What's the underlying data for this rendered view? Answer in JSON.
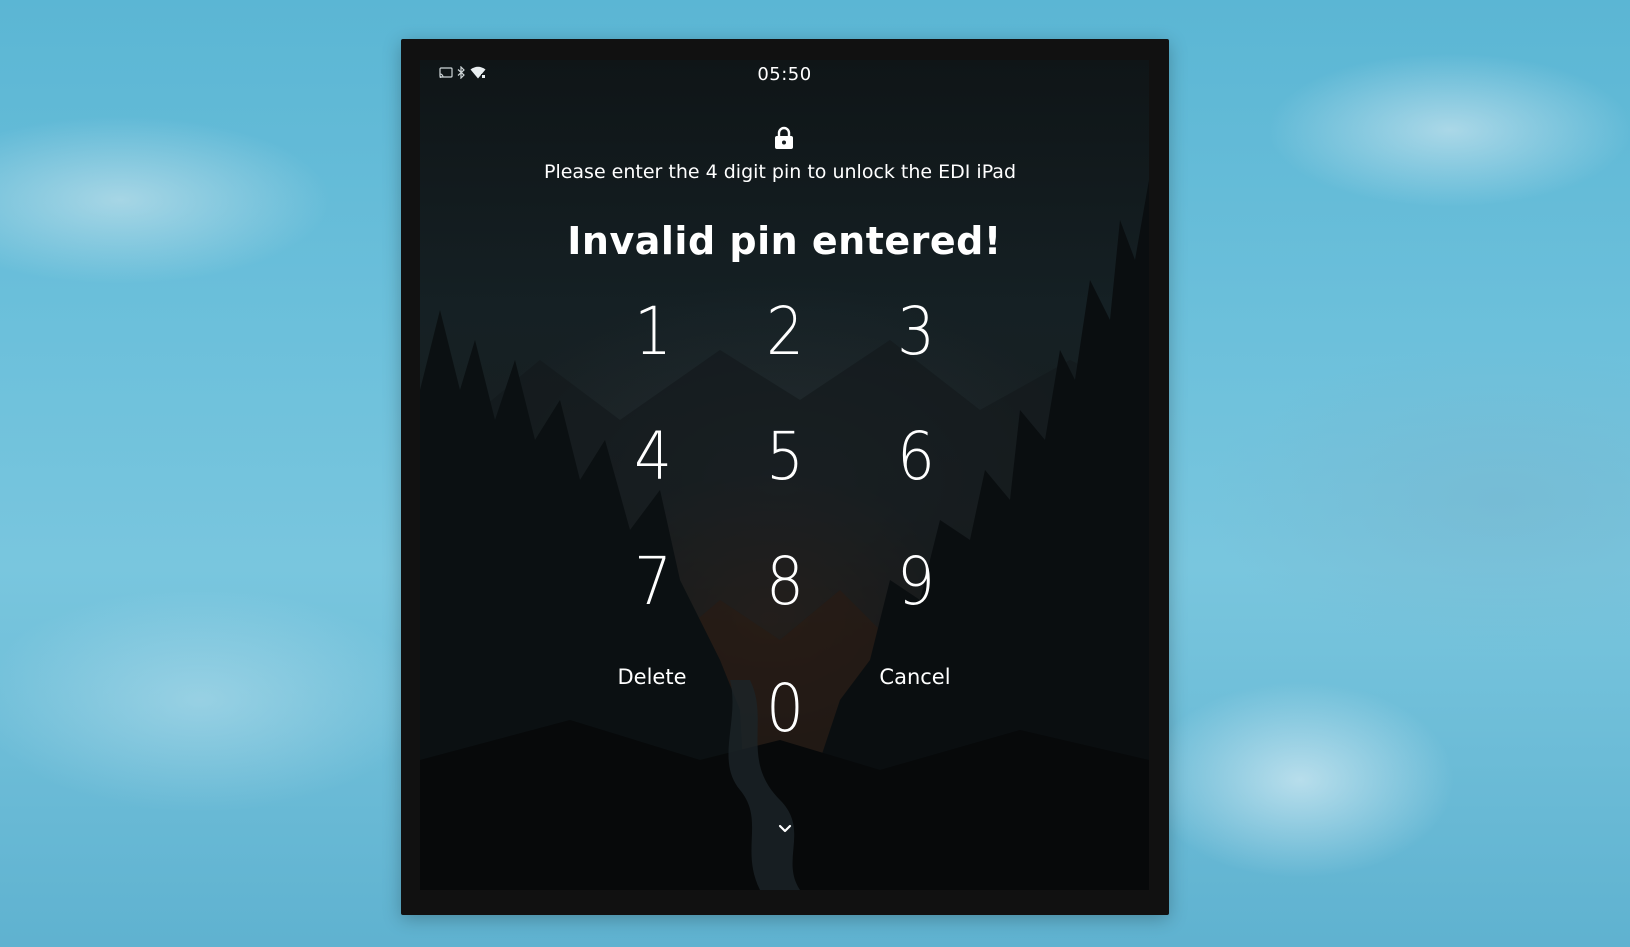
{
  "status_bar": {
    "time": "05:50",
    "icons": [
      "cast-icon",
      "bluetooth-icon",
      "wifi-icon"
    ]
  },
  "lock_screen": {
    "lock_icon": "lock-icon",
    "prompt": "Please enter the 4 digit pin to unlock the EDI iPad",
    "error": "Invalid pin entered!",
    "keys": [
      "1",
      "2",
      "3",
      "4",
      "5",
      "6",
      "7",
      "8",
      "9",
      "0"
    ],
    "delete_label": "Delete",
    "cancel_label": "Cancel",
    "collapse_icon": "chevron-down-icon"
  },
  "colors": {
    "text": "#ffffff",
    "device_bezel": "#111111",
    "desktop_background": "#6cc0db"
  }
}
